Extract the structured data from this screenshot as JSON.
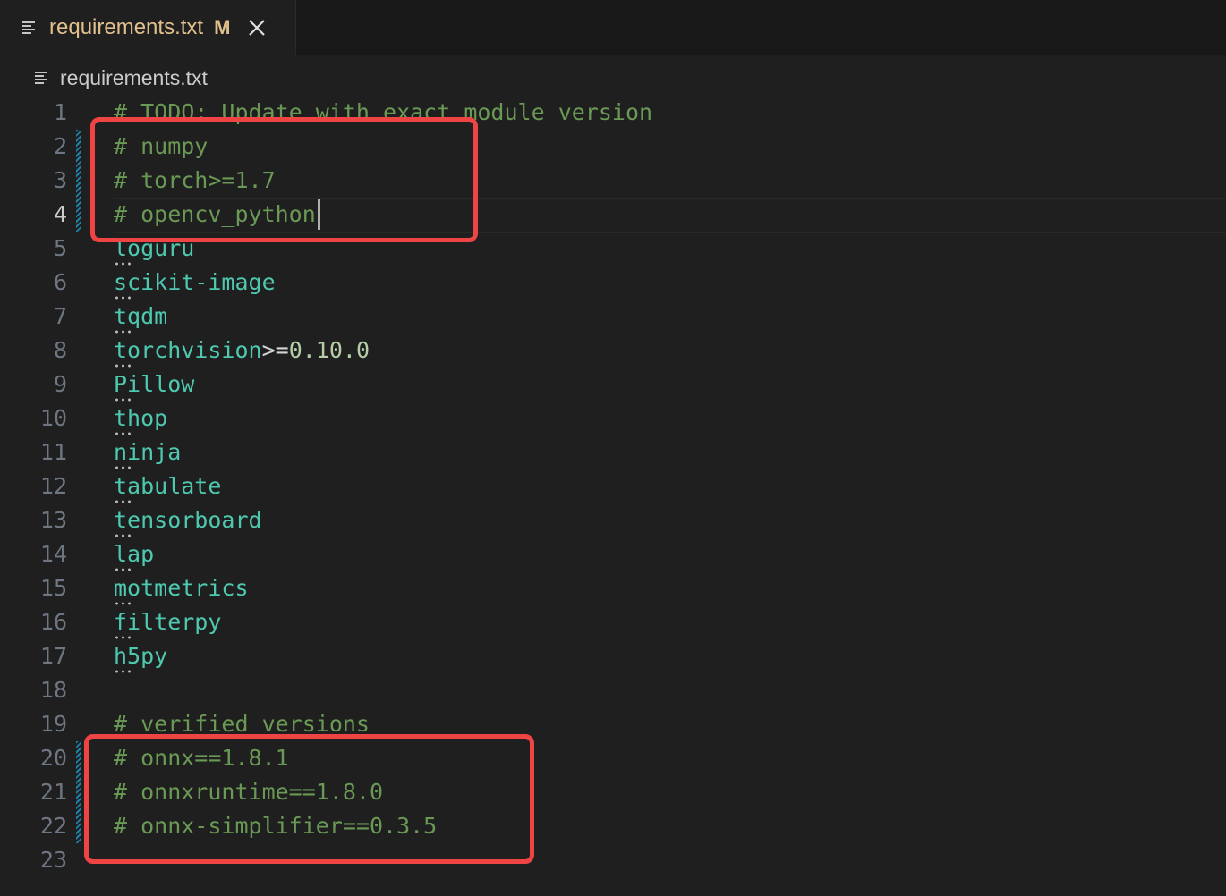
{
  "tab": {
    "filename": "requirements.txt",
    "modified_badge": "M",
    "icon": "list-lines-icon",
    "close_icon": "close-icon"
  },
  "breadcrumb": {
    "filename": "requirements.txt",
    "icon": "list-lines-icon"
  },
  "editor": {
    "current_line": 4,
    "lines": [
      {
        "n": "1",
        "text": "# TODO: Update with exact module version"
      },
      {
        "n": "2",
        "text": "# numpy"
      },
      {
        "n": "3",
        "text": "# torch>=1.7"
      },
      {
        "n": "4",
        "text": "# opencv_python"
      },
      {
        "n": "5",
        "pkg": "loguru"
      },
      {
        "n": "6",
        "pkg": "scikit-image"
      },
      {
        "n": "7",
        "pkg": "tqdm"
      },
      {
        "n": "8",
        "pkg": "torchvision",
        "op": ">=",
        "ver": "0.10.0"
      },
      {
        "n": "9",
        "pkg": "Pillow"
      },
      {
        "n": "10",
        "pkg": "thop"
      },
      {
        "n": "11",
        "pkg": "ninja"
      },
      {
        "n": "12",
        "pkg": "tabulate"
      },
      {
        "n": "13",
        "pkg": "tensorboard"
      },
      {
        "n": "14",
        "pkg": "lap"
      },
      {
        "n": "15",
        "pkg": "motmetrics"
      },
      {
        "n": "16",
        "pkg": "filterpy"
      },
      {
        "n": "17",
        "pkg": "h5py"
      },
      {
        "n": "18",
        "text": ""
      },
      {
        "n": "19",
        "text": "# verified versions"
      },
      {
        "n": "20",
        "text": "# onnx==1.8.1"
      },
      {
        "n": "21",
        "text": "# onnxruntime==1.8.0"
      },
      {
        "n": "22",
        "text": "# onnx-simplifier==0.3.5"
      },
      {
        "n": "23",
        "text": ""
      }
    ]
  },
  "colors": {
    "background": "#1f1f1f",
    "comment": "#6a9955",
    "package": "#4ec9b0",
    "version": "#b5cea8",
    "tab_modified": "#e2c08d",
    "annotation_box": "#ef4444",
    "modified_gutter": "#1b81a8"
  }
}
